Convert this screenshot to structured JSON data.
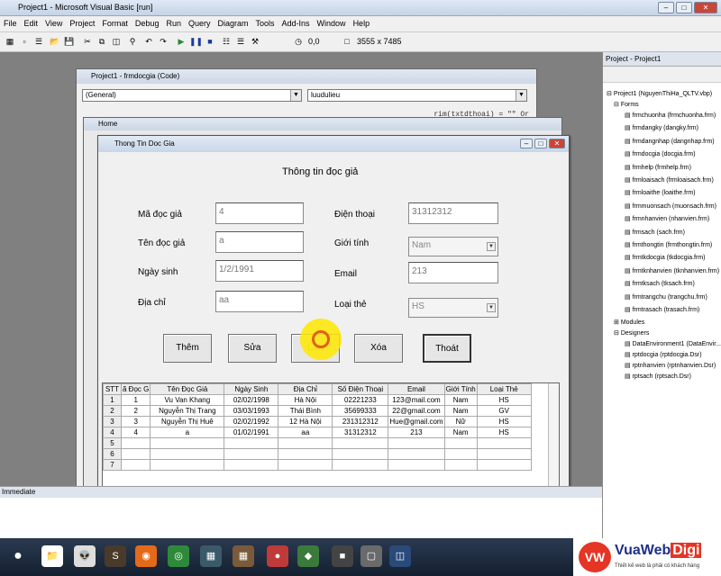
{
  "app": {
    "title": "Project1 - Microsoft Visual Basic [run]"
  },
  "menu": [
    "File",
    "Edit",
    "View",
    "Project",
    "Format",
    "Debug",
    "Run",
    "Query",
    "Diagram",
    "Tools",
    "Add-Ins",
    "Window",
    "Help"
  ],
  "toolbar": {
    "position": "0,0",
    "size": "3555 x 7485"
  },
  "code_window": {
    "title": "Project1 - frmdocgia (Code)",
    "object_combo": "(General)",
    "proc_combo": "luudulieu",
    "code_snippet": "rim(txtdthoai) = \"\" Or"
  },
  "home_window": {
    "title": "Home"
  },
  "form": {
    "title": "Thong Tin Doc Gia",
    "heading": "Thông tin đọc giả",
    "fields": {
      "ma_label": "Mã đọc giả",
      "ma_value": "4",
      "ten_label": "Tên đọc giả",
      "ten_value": "a",
      "ngaysinh_label": "Ngày sinh",
      "ngaysinh_value": "1/2/1991",
      "diachi_label": "Địa chỉ",
      "diachi_value": "aa",
      "dienthoai_label": "Điện thoại",
      "dienthoai_value": "31312312",
      "gioitinh_label": "Giới tính",
      "gioitinh_value": "Nam",
      "email_label": "Email",
      "email_value": "213",
      "loaithe_label": "Loại thẻ",
      "loaithe_value": "HS"
    },
    "buttons": {
      "them": "Thêm",
      "sua": "Sửa",
      "luu": "Lưu",
      "xoa": "Xóa",
      "thoat": "Thoát"
    },
    "grid": {
      "headers": [
        "STT",
        "ã Đọc G",
        "Tên Đọc Giả",
        "Ngày Sinh",
        "Địa Chỉ",
        "Số Điện Thoại",
        "Email",
        "Giới Tính",
        "Loại Thẻ"
      ],
      "rows": [
        [
          "1",
          "1",
          "Vu Van Khang",
          "02/02/1998",
          "Hà Nội",
          "02221233",
          "123@mail.com",
          "Nam",
          "HS"
        ],
        [
          "2",
          "2",
          "Nguyễn Thị Trang",
          "03/03/1993",
          "Thái Bình",
          "35699333",
          "22@gmail.com",
          "Nam",
          "GV"
        ],
        [
          "3",
          "3",
          "Nguyễn Thị Huê",
          "02/02/1992",
          "12 Hà Nội",
          "231312312",
          "Hue@gmail.com",
          "Nữ",
          "HS"
        ],
        [
          "4",
          "4",
          "a",
          "01/02/1991",
          "aa",
          "31312312",
          "213",
          "Nam",
          "HS"
        ],
        [
          "5",
          "",
          "",
          "",
          "",
          "",
          "",
          "",
          ""
        ],
        [
          "6",
          "",
          "",
          "",
          "",
          "",
          "",
          "",
          ""
        ],
        [
          "7",
          "",
          "",
          "",
          "",
          "",
          "",
          "",
          ""
        ]
      ]
    }
  },
  "immediate": {
    "title": "Immediate"
  },
  "project_panel": {
    "title": "Project - Project1",
    "root": "Project1 (NguyenThiHa_QLTV.vbp)",
    "forms_folder": "Forms",
    "forms": [
      "frmchuonha (frmchuonha.frm)",
      "frmdangky (dangky.frm)",
      "frmdangnhap (dangnhap.frm)",
      "frmdocgia (docgia.frm)",
      "frmhelp (frmhelp.frm)",
      "frmloaisach (frmloaisach.frm)",
      "frmloaithe (loaithe.frm)",
      "frmmuonsach (muonsach.frm)",
      "frmnhanvien (nhanvien.frm)",
      "frmsach (sach.frm)",
      "frmthongtin (frmthongtin.frm)",
      "frmtkdocgia (tkdocgia.frm)",
      "frmtknhanvien (tknhanvien.frm)",
      "frmtksach (tksach.frm)",
      "frmtrangchu (trangchu.frm)",
      "frmtrasach (trasach.frm)"
    ],
    "modules_folder": "Modules",
    "designers_folder": "Designers",
    "designers": [
      "DataEnvironment1 (DataEnvir...",
      "rptdocgia (rptdocgia.Dsr)",
      "rptnhanvien (rptnhanvien.Dsr)",
      "rptsach (rptsach.Dsr)"
    ]
  },
  "logo": {
    "brand_a": "VuaWeb",
    "brand_b": "Digi",
    "tagline": "Thiết kế web là phải có khách hàng"
  }
}
